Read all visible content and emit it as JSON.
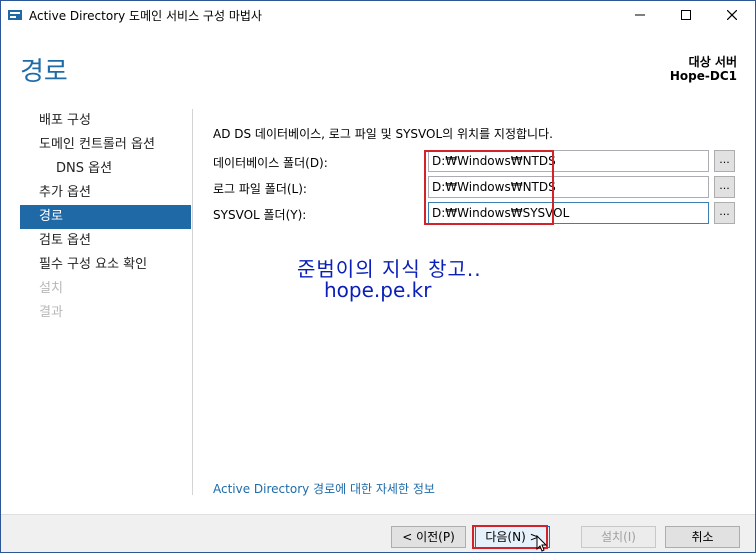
{
  "window": {
    "title": "Active Directory 도메인 서비스 구성 마법사",
    "controls": {
      "minimize": "—",
      "maximize": "☐",
      "close": "✕"
    }
  },
  "header": {
    "page_title": "경로",
    "target_label": "대상 서버",
    "target_name": "Hope-DC1"
  },
  "sidebar": {
    "items": [
      {
        "label": "배포 구성",
        "state": "normal"
      },
      {
        "label": "도메인 컨트롤러 옵션",
        "state": "normal"
      },
      {
        "label": "DNS 옵션",
        "state": "sub"
      },
      {
        "label": "추가 옵션",
        "state": "normal"
      },
      {
        "label": "경로",
        "state": "active"
      },
      {
        "label": "검토 옵션",
        "state": "normal"
      },
      {
        "label": "필수 구성 요소 확인",
        "state": "normal"
      },
      {
        "label": "설치",
        "state": "disabled"
      },
      {
        "label": "결과",
        "state": "disabled"
      }
    ]
  },
  "main": {
    "intro": "AD DS 데이터베이스, 로그 파일 및 SYSVOL의 위치를 지정합니다.",
    "fields": [
      {
        "label": "데이터베이스 폴더(D):",
        "value": "D:₩Windows₩NTDS",
        "browse": "..."
      },
      {
        "label": "로그 파일 폴더(L):",
        "value": "D:₩Windows₩NTDS",
        "browse": "..."
      },
      {
        "label": "SYSVOL 폴더(Y):",
        "value": "D:₩Windows₩SYSVOL",
        "browse": "..."
      }
    ],
    "watermark_line1": "준범이의 지식 창고..",
    "watermark_line2": "hope.pe.kr",
    "more_info_link": "Active Directory 경로에 대한 자세한 정보"
  },
  "footer": {
    "prev": "< 이전(P)",
    "next": "다음(N) >",
    "install": "설치(I)",
    "cancel": "취소"
  },
  "colors": {
    "accent": "#1f6aa6",
    "heading": "#1e6ba8",
    "highlight": "#d3232a",
    "watermark": "#0a1fb8"
  }
}
